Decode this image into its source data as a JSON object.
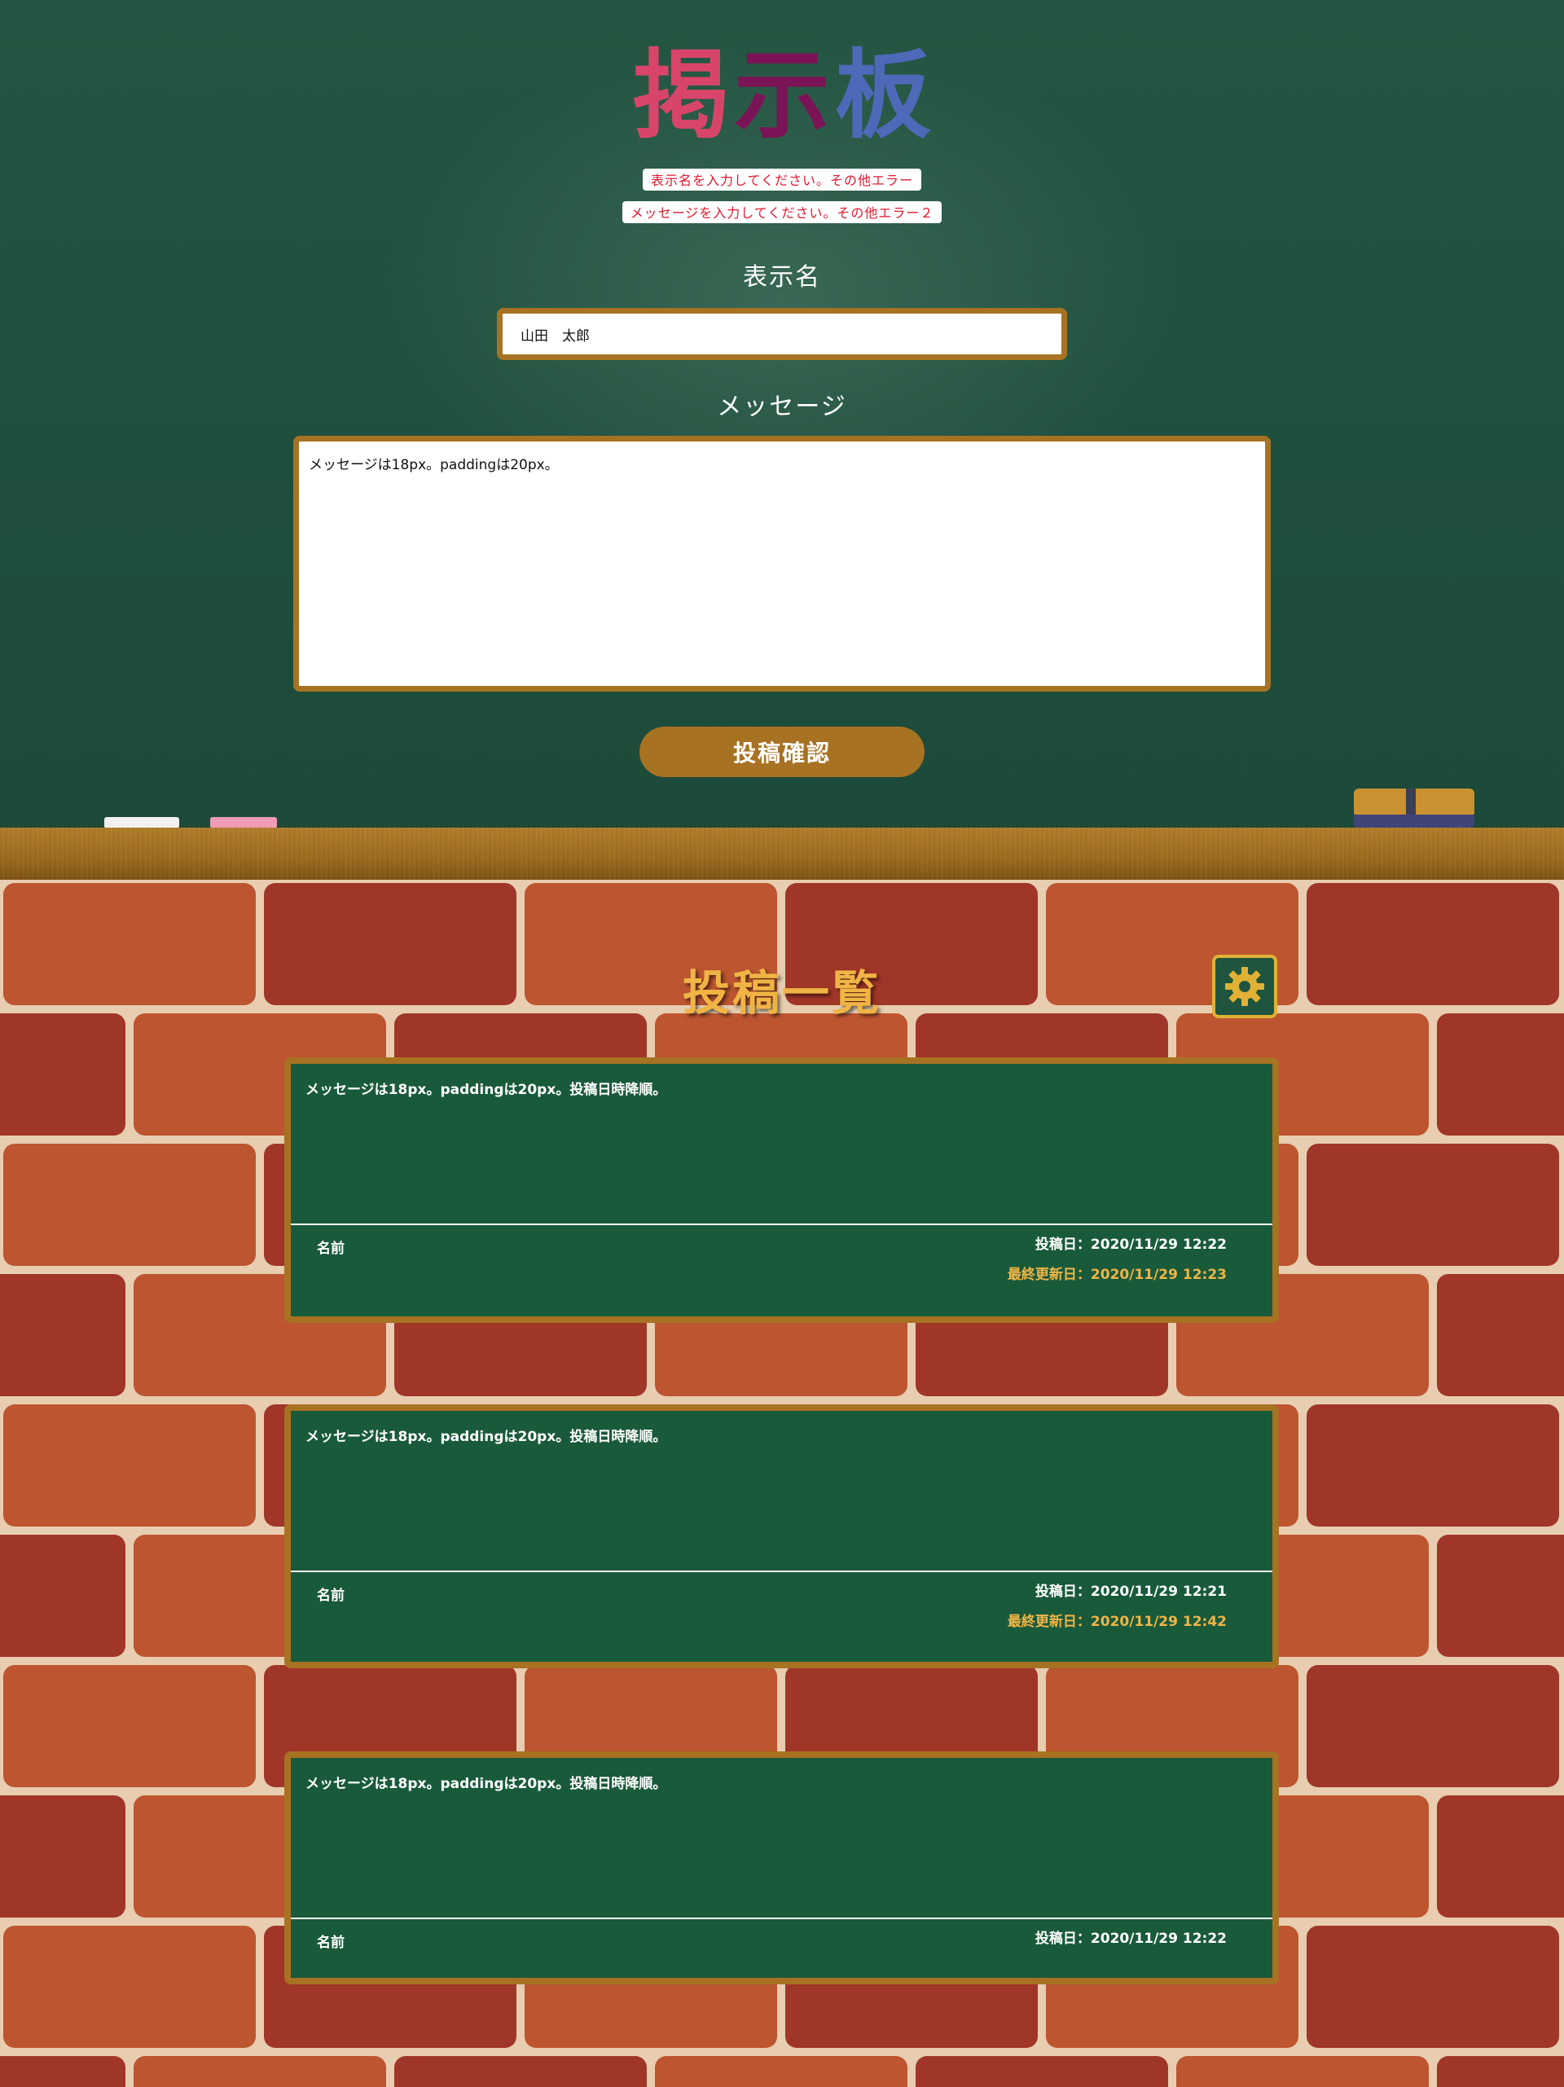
{
  "board": {
    "title_chars": [
      "掲",
      "示",
      "板"
    ],
    "errors": [
      "表示名を入力してください。その他エラー",
      "メッセージを入力してください。その他エラー２"
    ],
    "name_label": "表示名",
    "name_value": "山田　太郎",
    "message_label": "メッセージ",
    "message_value": "メッセージは18px。paddingは20px。",
    "confirm_button": "投稿確認"
  },
  "list": {
    "title": "投稿一覧",
    "settings_icon": "gear-icon",
    "posts": [
      {
        "message": "メッセージは18px。paddingは20px。投稿日時降順。",
        "name": "名前",
        "posted": "投稿日：2020/11/29 12:22",
        "updated": "最終更新日：2020/11/29 12:23"
      },
      {
        "message": "メッセージは18px。paddingは20px。投稿日時降順。",
        "name": "名前",
        "posted": "投稿日：2020/11/29 12:21",
        "updated": "最終更新日：2020/11/29 12:42"
      },
      {
        "message": "メッセージは18px。paddingは20px。投稿日時降順。",
        "name": "名前",
        "posted": "投稿日：2020/11/29 12:22"
      }
    ]
  },
  "colors": {
    "board": "#245643",
    "frame": "#a87223",
    "error_text": "#e4172e",
    "title_accent": "#f0b445",
    "post_bg": "#195a3b"
  }
}
